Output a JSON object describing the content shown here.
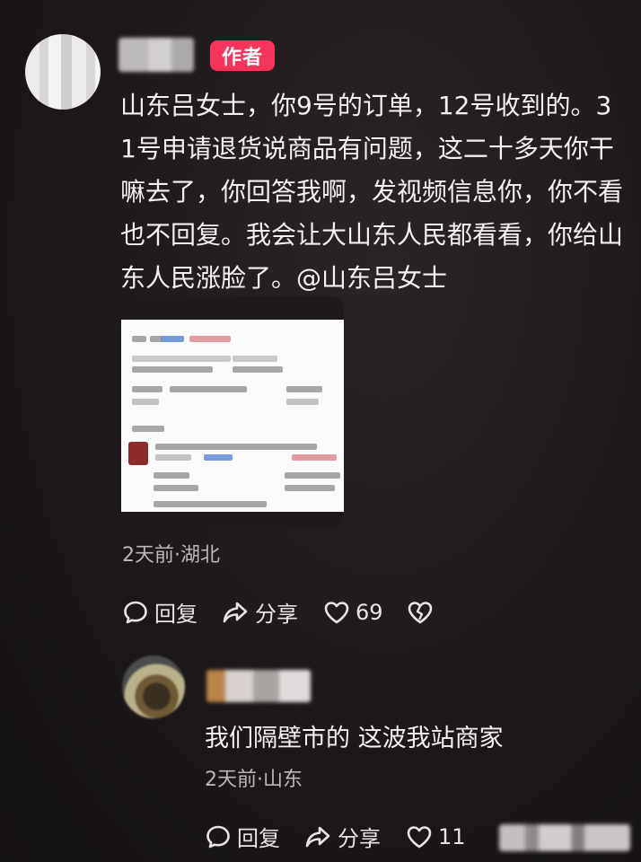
{
  "comment": {
    "author_badge": "作者",
    "text": "山东吕女士，你9号的订单，12号收到的。31号申请退货说商品有问题，这二十多天你干嘛去了，你回答我啊，发视频信息你，你不看也不回复。我会让大山东人民都看看，你给山东人民涨脸了。@山东吕女士",
    "meta": "2天前·湖北",
    "actions": {
      "reply_label": "回复",
      "share_label": "分享",
      "like_count": "69"
    }
  },
  "reply": {
    "text": "我们隔壁市的 这波我站商家",
    "meta": "2天前·山东",
    "actions": {
      "reply_label": "回复",
      "share_label": "分享",
      "like_count": "11"
    }
  },
  "colors": {
    "badge": "#f7345a",
    "background": "#1c1819"
  }
}
